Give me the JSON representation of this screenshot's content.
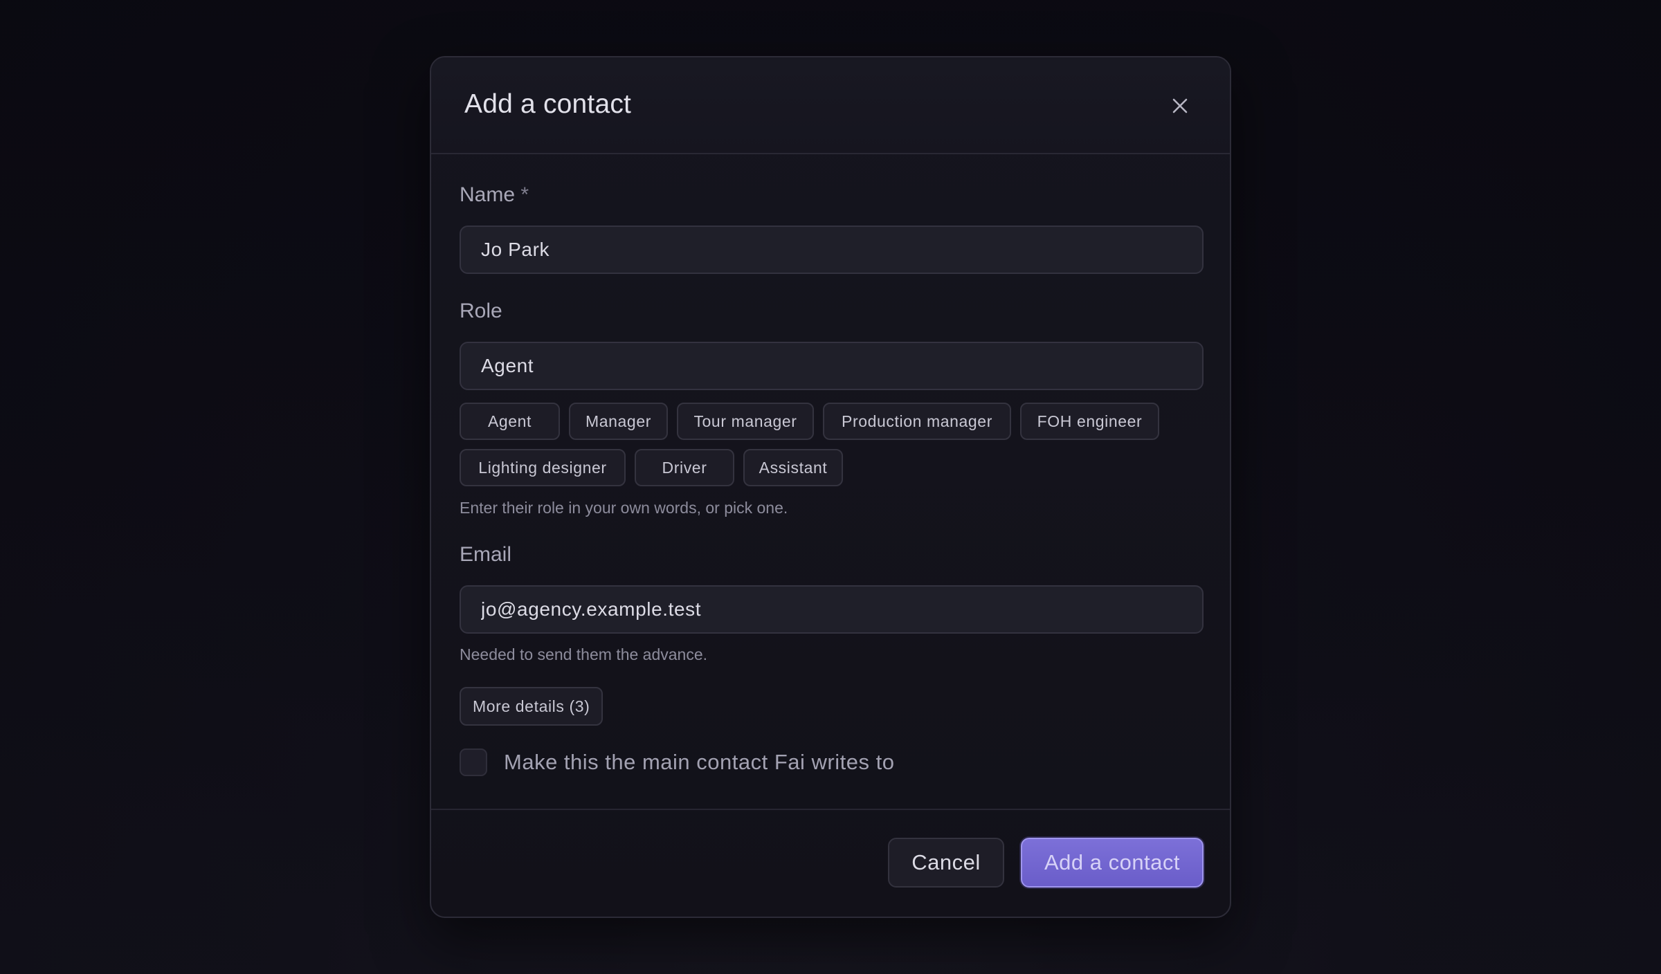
{
  "dialog": {
    "title": "Add a contact",
    "close_icon": "close-icon"
  },
  "fields": {
    "name": {
      "label": "Name",
      "required_marker": "*",
      "value": "Jo Park"
    },
    "role": {
      "label": "Role",
      "value": "Agent",
      "suggestions": [
        "Agent",
        "Manager",
        "Tour manager",
        "Production manager",
        "FOH engineer",
        "Lighting designer",
        "Driver",
        "Assistant"
      ],
      "hint": "Enter their role in your own words, or pick one."
    },
    "email": {
      "label": "Email",
      "value": "jo@agency.example.test",
      "hint": "Needed to send them the advance."
    }
  },
  "more_details": {
    "label": "More details (3)"
  },
  "main_contact": {
    "label": "Make this the main contact Fai writes to",
    "checked": false
  },
  "footer": {
    "cancel_label": "Cancel",
    "submit_label": "Add a contact"
  },
  "colors": {
    "primary": "#6f62d1",
    "background": "#0d0c14",
    "surface": "#14131c"
  }
}
